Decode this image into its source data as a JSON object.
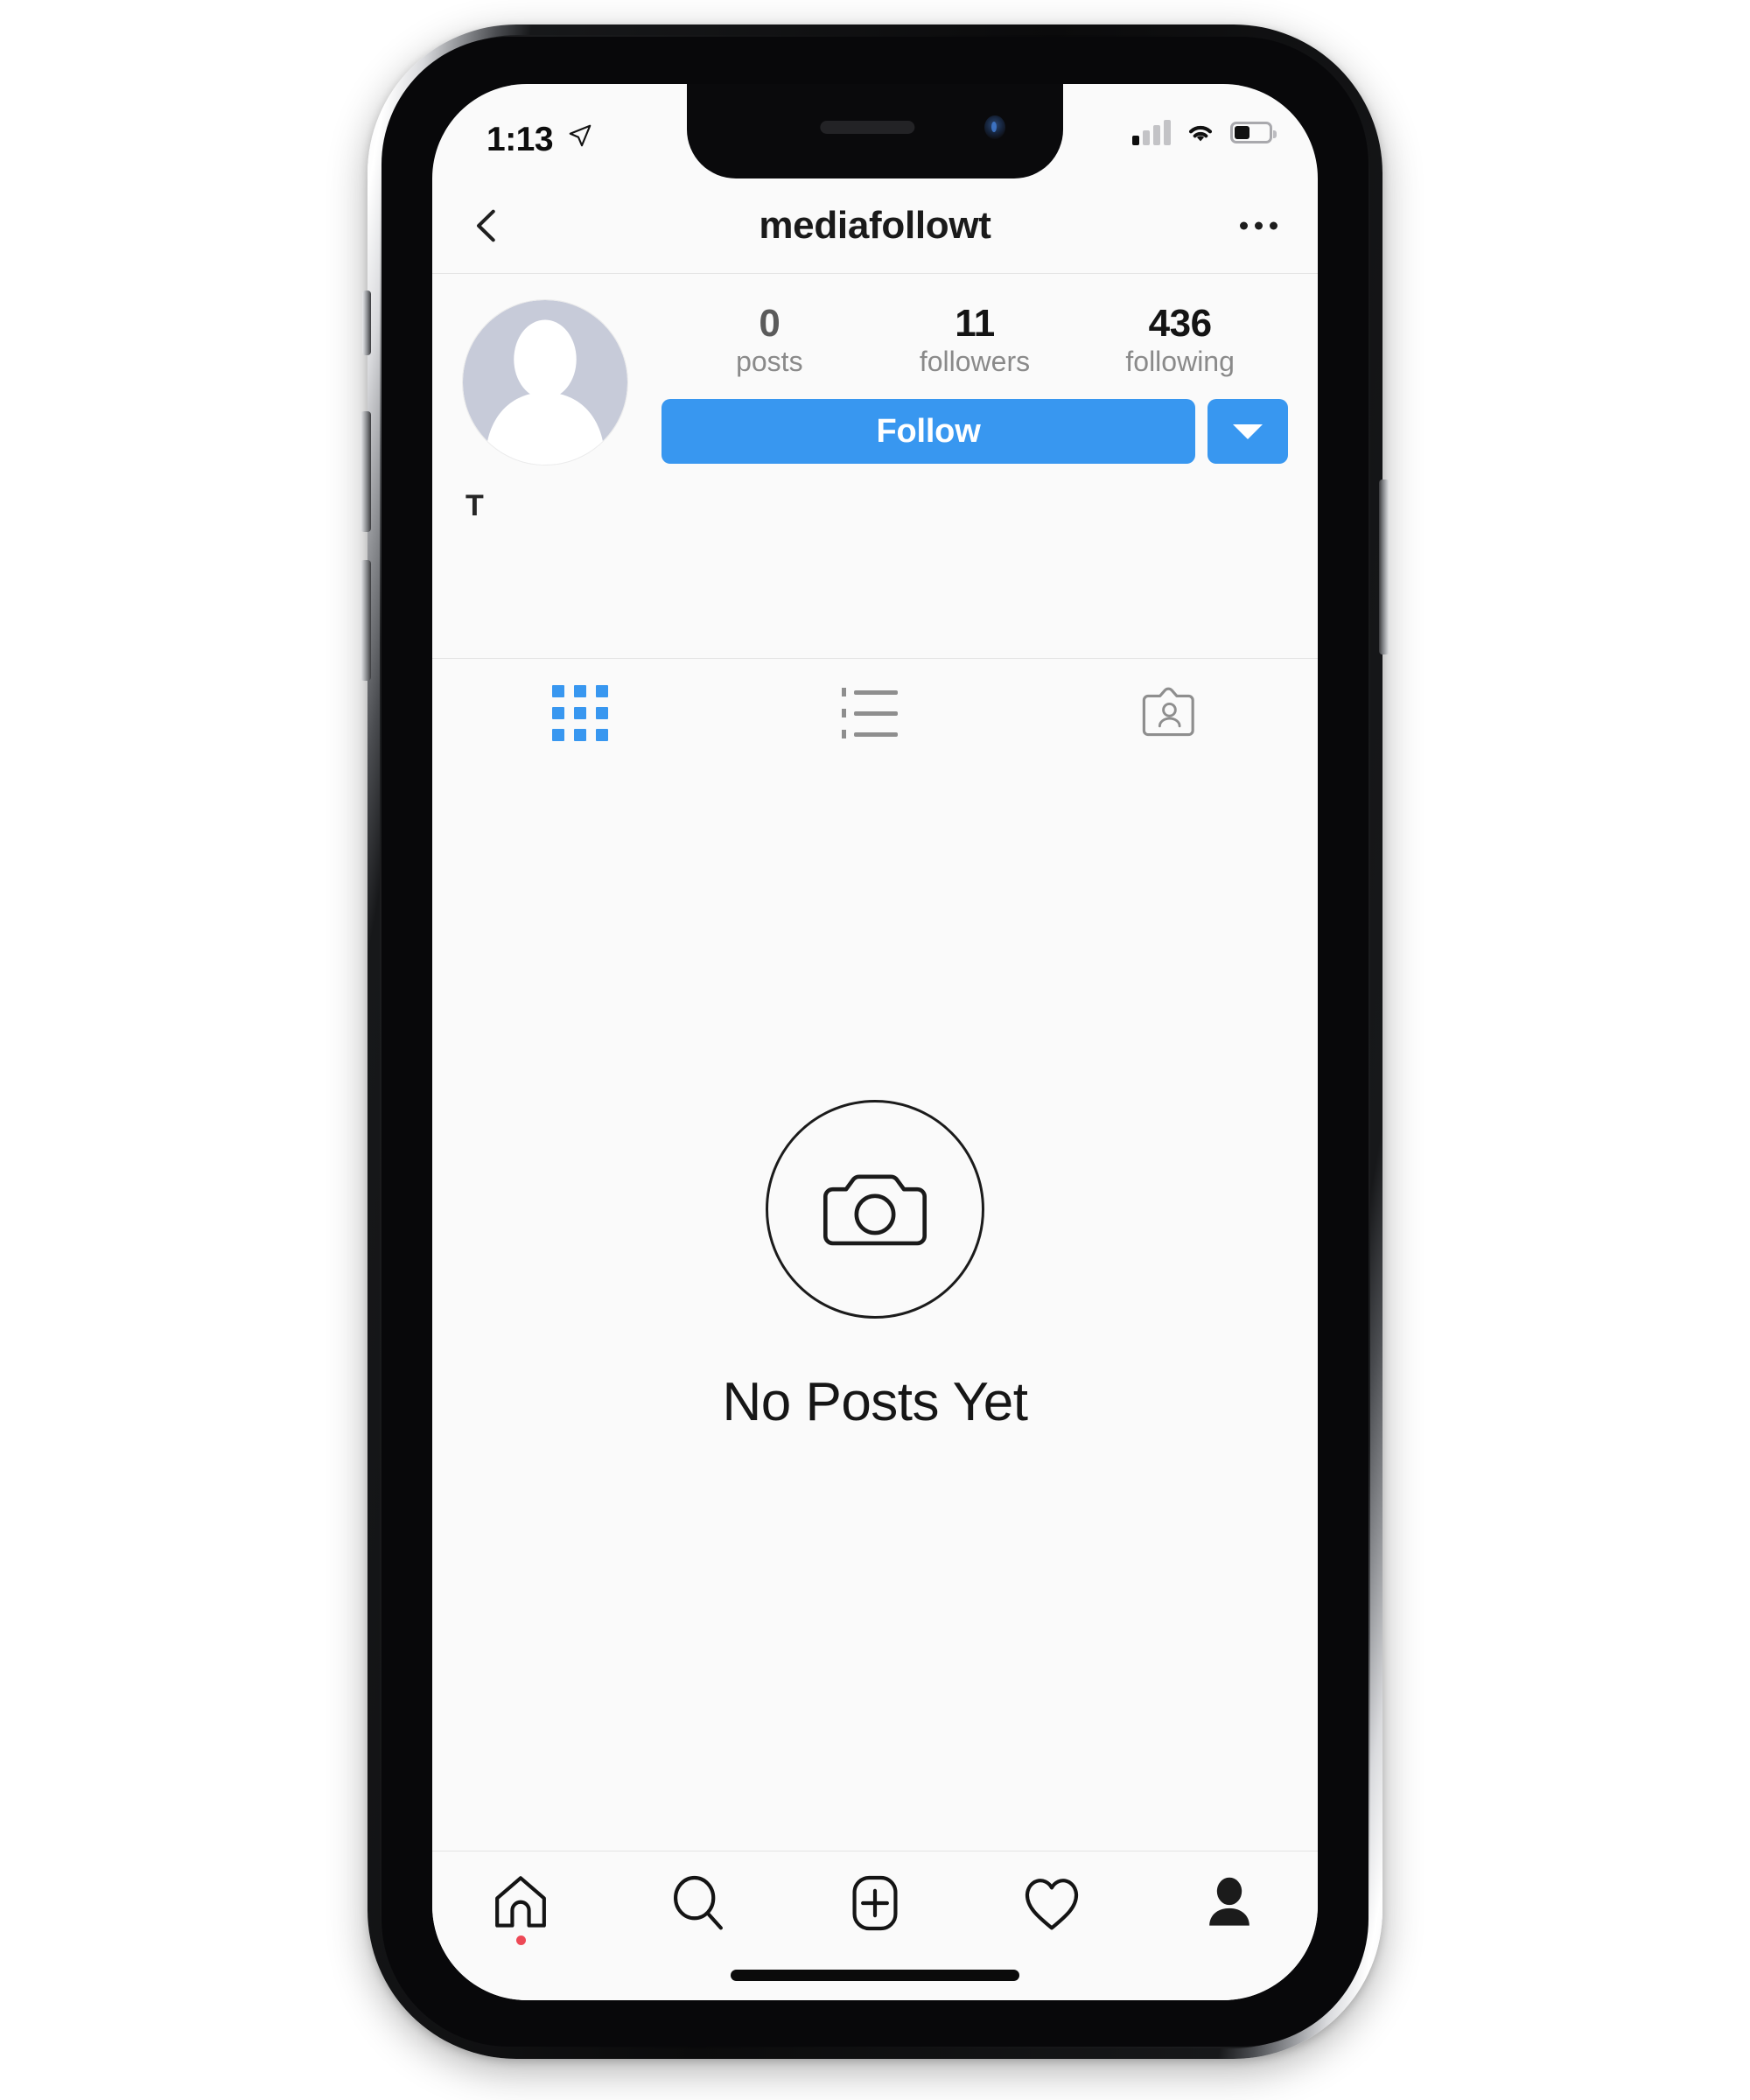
{
  "status_bar": {
    "time": "1:13",
    "location_icon": "location-arrow-icon",
    "signal_icon": "cellular-signal-icon",
    "signal_bars_filled": 1,
    "signal_bars_total": 4,
    "wifi_icon": "wifi-icon",
    "battery_icon": "battery-icon",
    "battery_percent": 40
  },
  "header": {
    "back_icon": "chevron-left-icon",
    "title": "mediafollowt",
    "more_icon": "more-options-icon"
  },
  "profile": {
    "avatar_icon": "default-avatar-icon",
    "display_name": "T",
    "stats": [
      {
        "num": "0",
        "label": "posts",
        "name": "posts"
      },
      {
        "num": "11",
        "label": "followers",
        "name": "followers"
      },
      {
        "num": "436",
        "label": "following",
        "name": "following"
      }
    ],
    "follow_label": "Follow",
    "dropdown_icon": "chevron-down-icon"
  },
  "tabs": [
    {
      "name": "grid",
      "icon": "grid-icon",
      "active": true
    },
    {
      "name": "list",
      "icon": "list-icon",
      "active": false
    },
    {
      "name": "tagged",
      "icon": "tagged-icon",
      "active": false
    }
  ],
  "empty_state": {
    "icon": "camera-icon",
    "text": "No Posts Yet"
  },
  "bottom_nav": [
    {
      "name": "home",
      "icon": "home-icon",
      "badge": true
    },
    {
      "name": "search",
      "icon": "search-icon",
      "badge": false
    },
    {
      "name": "create",
      "icon": "plus-square-icon",
      "badge": false
    },
    {
      "name": "activity",
      "icon": "heart-icon",
      "badge": false
    },
    {
      "name": "profile",
      "icon": "person-filled-icon",
      "badge": false
    }
  ],
  "colors": {
    "accent_blue": "#3897f0",
    "badge_red": "#ed4956",
    "screen_bg": "#fafafa",
    "avatar_gray": "#c7cbd9"
  }
}
